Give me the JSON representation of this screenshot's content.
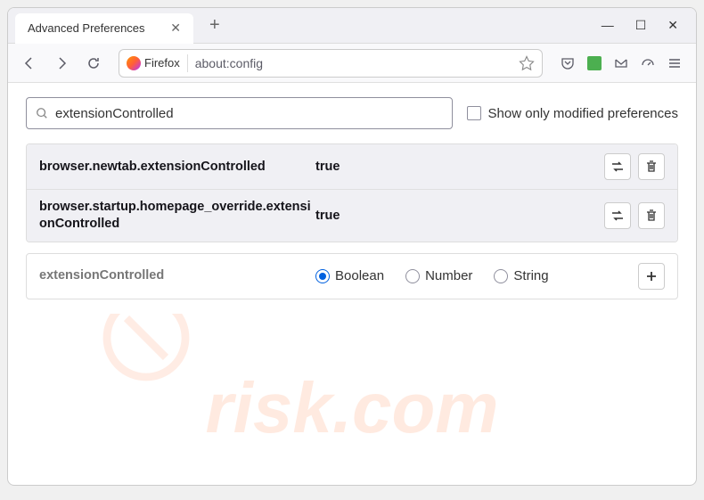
{
  "window": {
    "tab_title": "Advanced Preferences",
    "controls": {
      "min": "—",
      "max": "☐",
      "close": "✕"
    }
  },
  "toolbar": {
    "firefox_label": "Firefox",
    "url": "about:config"
  },
  "search": {
    "value": "extensionControlled",
    "checkbox_label": "Show only modified preferences"
  },
  "prefs": [
    {
      "name": "browser.newtab.extensionControlled",
      "value": "true",
      "modified": true
    },
    {
      "name": "browser.startup.homepage_override.extensionControlled",
      "value": "true",
      "modified": true
    }
  ],
  "new_pref": {
    "name": "extensionControlled",
    "types": [
      "Boolean",
      "Number",
      "String"
    ],
    "selected": "Boolean"
  },
  "watermark": "risk.com"
}
